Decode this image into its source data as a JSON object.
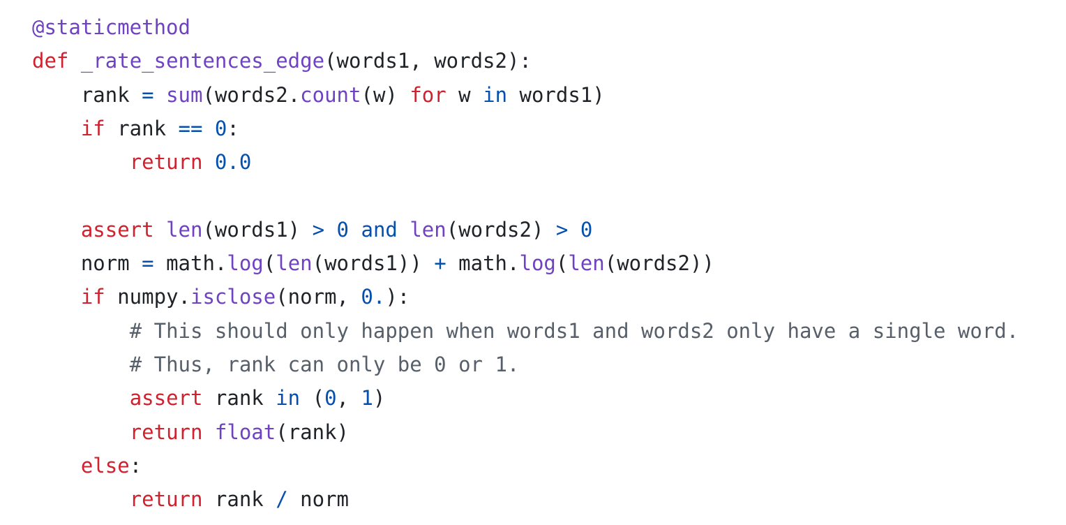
{
  "editor": {
    "language": "python",
    "colors": {
      "background": "#ffffff",
      "plain": "#1f2328",
      "keyword": "#cf222e",
      "function": "#6f42c1",
      "operator": "#0550ae",
      "number": "#0550ae",
      "decorator": "#6f42c1",
      "comment": "#57606a"
    },
    "lines": [
      {
        "indent": 0,
        "tokens": [
          {
            "t": "dec",
            "v": "@staticmethod"
          }
        ]
      },
      {
        "indent": 0,
        "tokens": [
          {
            "t": "kw",
            "v": "def"
          },
          {
            "t": "plain",
            "v": " "
          },
          {
            "t": "fn",
            "v": "_rate_sentences_edge"
          },
          {
            "t": "plain",
            "v": "(words1, words2):"
          }
        ]
      },
      {
        "indent": 1,
        "tokens": [
          {
            "t": "plain",
            "v": "rank "
          },
          {
            "t": "op",
            "v": "="
          },
          {
            "t": "plain",
            "v": " "
          },
          {
            "t": "fn",
            "v": "sum"
          },
          {
            "t": "plain",
            "v": "(words2."
          },
          {
            "t": "fn",
            "v": "count"
          },
          {
            "t": "plain",
            "v": "(w) "
          },
          {
            "t": "kw",
            "v": "for"
          },
          {
            "t": "plain",
            "v": " w "
          },
          {
            "t": "op",
            "v": "in"
          },
          {
            "t": "plain",
            "v": " words1)"
          }
        ]
      },
      {
        "indent": 1,
        "tokens": [
          {
            "t": "kw",
            "v": "if"
          },
          {
            "t": "plain",
            "v": " rank "
          },
          {
            "t": "op",
            "v": "=="
          },
          {
            "t": "plain",
            "v": " "
          },
          {
            "t": "num",
            "v": "0"
          },
          {
            "t": "plain",
            "v": ":"
          }
        ]
      },
      {
        "indent": 2,
        "tokens": [
          {
            "t": "kw",
            "v": "return"
          },
          {
            "t": "plain",
            "v": " "
          },
          {
            "t": "num",
            "v": "0.0"
          }
        ]
      },
      {
        "indent": 0,
        "tokens": []
      },
      {
        "indent": 1,
        "tokens": [
          {
            "t": "kw",
            "v": "assert"
          },
          {
            "t": "plain",
            "v": " "
          },
          {
            "t": "fn",
            "v": "len"
          },
          {
            "t": "plain",
            "v": "(words1) "
          },
          {
            "t": "op",
            "v": ">"
          },
          {
            "t": "plain",
            "v": " "
          },
          {
            "t": "num",
            "v": "0"
          },
          {
            "t": "plain",
            "v": " "
          },
          {
            "t": "op",
            "v": "and"
          },
          {
            "t": "plain",
            "v": " "
          },
          {
            "t": "fn",
            "v": "len"
          },
          {
            "t": "plain",
            "v": "(words2) "
          },
          {
            "t": "op",
            "v": ">"
          },
          {
            "t": "plain",
            "v": " "
          },
          {
            "t": "num",
            "v": "0"
          }
        ]
      },
      {
        "indent": 1,
        "tokens": [
          {
            "t": "plain",
            "v": "norm "
          },
          {
            "t": "op",
            "v": "="
          },
          {
            "t": "plain",
            "v": " math."
          },
          {
            "t": "fn",
            "v": "log"
          },
          {
            "t": "plain",
            "v": "("
          },
          {
            "t": "fn",
            "v": "len"
          },
          {
            "t": "plain",
            "v": "(words1)) "
          },
          {
            "t": "op",
            "v": "+"
          },
          {
            "t": "plain",
            "v": " math."
          },
          {
            "t": "fn",
            "v": "log"
          },
          {
            "t": "plain",
            "v": "("
          },
          {
            "t": "fn",
            "v": "len"
          },
          {
            "t": "plain",
            "v": "(words2))"
          }
        ]
      },
      {
        "indent": 1,
        "tokens": [
          {
            "t": "kw",
            "v": "if"
          },
          {
            "t": "plain",
            "v": " numpy."
          },
          {
            "t": "fn",
            "v": "isclose"
          },
          {
            "t": "plain",
            "v": "(norm, "
          },
          {
            "t": "num",
            "v": "0."
          },
          {
            "t": "plain",
            "v": "):"
          }
        ]
      },
      {
        "indent": 2,
        "tokens": [
          {
            "t": "comment",
            "v": "# This should only happen when words1 and words2 only have a single word."
          }
        ]
      },
      {
        "indent": 2,
        "tokens": [
          {
            "t": "comment",
            "v": "# Thus, rank can only be 0 or 1."
          }
        ]
      },
      {
        "indent": 2,
        "tokens": [
          {
            "t": "kw",
            "v": "assert"
          },
          {
            "t": "plain",
            "v": " rank "
          },
          {
            "t": "op",
            "v": "in"
          },
          {
            "t": "plain",
            "v": " ("
          },
          {
            "t": "num",
            "v": "0"
          },
          {
            "t": "plain",
            "v": ", "
          },
          {
            "t": "num",
            "v": "1"
          },
          {
            "t": "plain",
            "v": ")"
          }
        ]
      },
      {
        "indent": 2,
        "tokens": [
          {
            "t": "kw",
            "v": "return"
          },
          {
            "t": "plain",
            "v": " "
          },
          {
            "t": "fn",
            "v": "float"
          },
          {
            "t": "plain",
            "v": "(rank)"
          }
        ]
      },
      {
        "indent": 1,
        "tokens": [
          {
            "t": "kw",
            "v": "else"
          },
          {
            "t": "plain",
            "v": ":"
          }
        ]
      },
      {
        "indent": 2,
        "tokens": [
          {
            "t": "kw",
            "v": "return"
          },
          {
            "t": "plain",
            "v": " rank "
          },
          {
            "t": "op",
            "v": "/"
          },
          {
            "t": "plain",
            "v": " norm"
          }
        ]
      }
    ]
  }
}
